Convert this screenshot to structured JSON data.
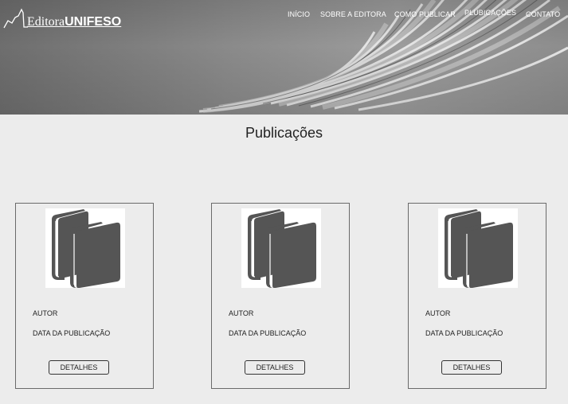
{
  "header": {
    "logo": {
      "text_regular": "Editora",
      "text_bold": "UNIFESO",
      "icon": "mountain-line-icon"
    },
    "nav": [
      {
        "label": "INÍCIO"
      },
      {
        "label": "SOBRE A EDITORA"
      },
      {
        "label": "COMO PUBLICAR"
      },
      {
        "label": "PLUBICAÇÕES"
      },
      {
        "label": "CONTATO"
      }
    ]
  },
  "main": {
    "title": "Publicações",
    "cards": [
      {
        "icon": "books-icon",
        "author": "AUTOR",
        "date": "DATA DA PUBLICAÇÃO",
        "button": "DETALHES"
      },
      {
        "icon": "books-icon",
        "author": "AUTOR",
        "date": "DATA DA PUBLICAÇÃO",
        "button": "DETALHES"
      },
      {
        "icon": "books-icon",
        "author": "AUTOR",
        "date": "DATA DA PUBLICAÇÃO",
        "button": "DETALHES"
      }
    ]
  },
  "colors": {
    "page_bg": "#ececec",
    "card_border": "#6a6a6a",
    "icon_fill": "#555555",
    "nav_text": "#ffffff"
  }
}
